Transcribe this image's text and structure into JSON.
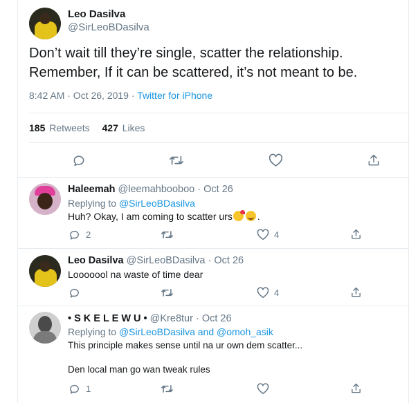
{
  "main_tweet": {
    "name": "Leo Dasilva",
    "handle": "@SirLeoBDasilva",
    "text_line1": "Don’t wait till they’re single, scatter the relationship.",
    "text_line2": "Remember, If it can be scattered, it’s not meant to be.",
    "time": "8:42 AM · Oct 26, 2019 · ",
    "source": "Twitter for iPhone",
    "retweet_count": "185",
    "retweet_label": "Retweets",
    "like_count": "427",
    "like_label": "Likes"
  },
  "replies": [
    {
      "name": "Haleemah",
      "handle": "@leemahbooboo",
      "date": "· Oct 26",
      "replying_prefix": "Replying to ",
      "replying_to": "@SirLeoBDasilva",
      "text": "Huh? Okay, I am coming to scatter urs",
      "text_suffix": ".",
      "reply_count": "2",
      "like_count": "4"
    },
    {
      "name": "Leo Dasilva",
      "handle": "@SirLeoBDasilva",
      "date": "· Oct 26",
      "text": "Looooool na waste of time dear",
      "like_count": "4"
    },
    {
      "name": "• S K E L E W U •",
      "handle": "@Kre8tur",
      "date": "· Oct 26",
      "replying_prefix": "Replying to ",
      "replying_to": "@SirLeoBDasilva and @omoh_asik",
      "text_line1": "This principle makes sense until na ur own dem scatter...",
      "text_line2": "Den local man go wan tweak rules",
      "reply_count": "1"
    }
  ],
  "colors": {
    "link": "#1b95e0",
    "muted": "#657786",
    "divider": "#e6ecf0"
  },
  "icons": [
    "reply-icon",
    "retweet-icon",
    "like-icon",
    "share-icon",
    "emoji-kiss-icon",
    "emoji-smile-icon"
  ]
}
